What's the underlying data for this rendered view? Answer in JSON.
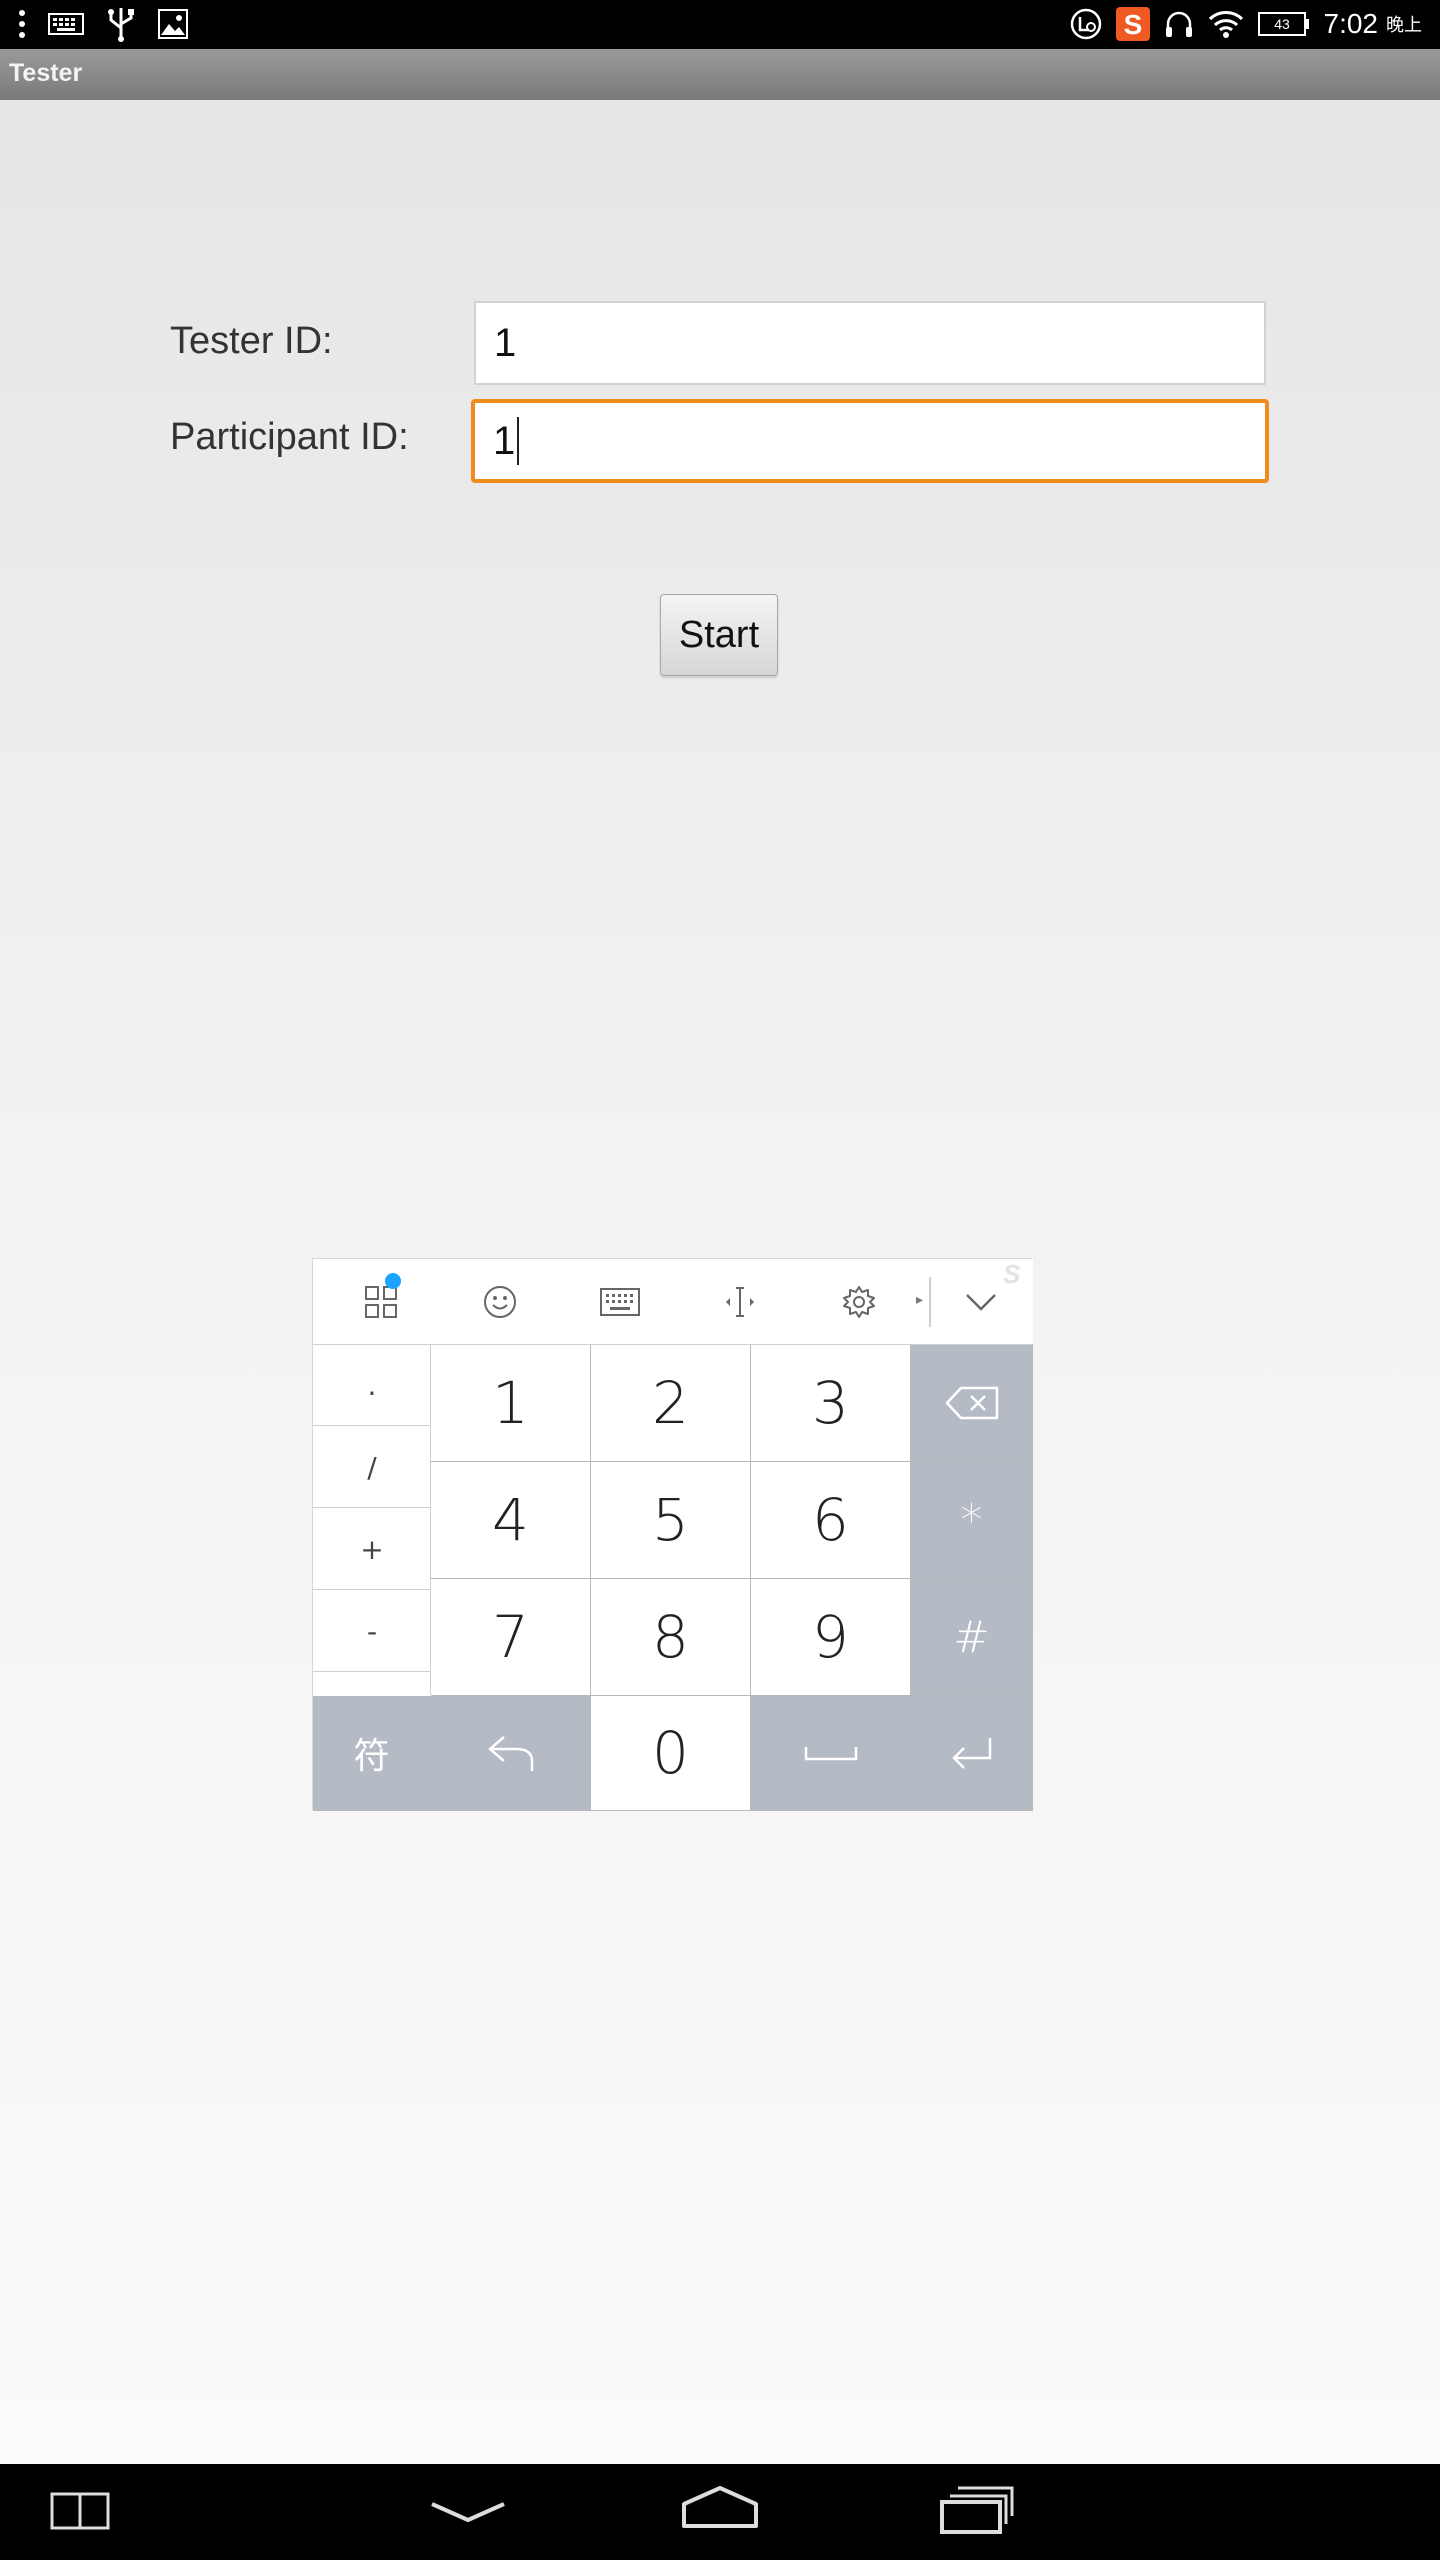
{
  "status_bar": {
    "time": "7:02",
    "ampm": "晚上",
    "battery": "43",
    "icons_left": [
      "more-icon",
      "keyboard-icon",
      "usb-icon",
      "image-icon"
    ],
    "icons_right": [
      "sync-icon",
      "sogou-icon",
      "headset-icon",
      "wifi-icon",
      "battery-icon"
    ]
  },
  "app": {
    "title": "Tester"
  },
  "form": {
    "tester_label": "Tester ID:",
    "tester_value": "1",
    "participant_label": "Participant ID:",
    "participant_value": "1",
    "start_label": "Start"
  },
  "keyboard": {
    "toolbar_icons": [
      "apps-grid-icon",
      "emoji-icon",
      "keyboard-icon",
      "cursor-move-icon",
      "settings-icon",
      "collapse-chevron-icon"
    ],
    "symbols": [
      ".",
      "/",
      "+",
      "-"
    ],
    "rows": [
      [
        "1",
        "2",
        "3"
      ],
      [
        "4",
        "5",
        "6"
      ],
      [
        "7",
        "8",
        "9"
      ]
    ],
    "star": "*",
    "hash": "#",
    "fu": "符",
    "zero": "0",
    "logo": "S"
  },
  "colors": {
    "focus_border": "#f08c1e",
    "key_gray": "#b4bbc5",
    "badge_blue": "#1aa3ff"
  }
}
